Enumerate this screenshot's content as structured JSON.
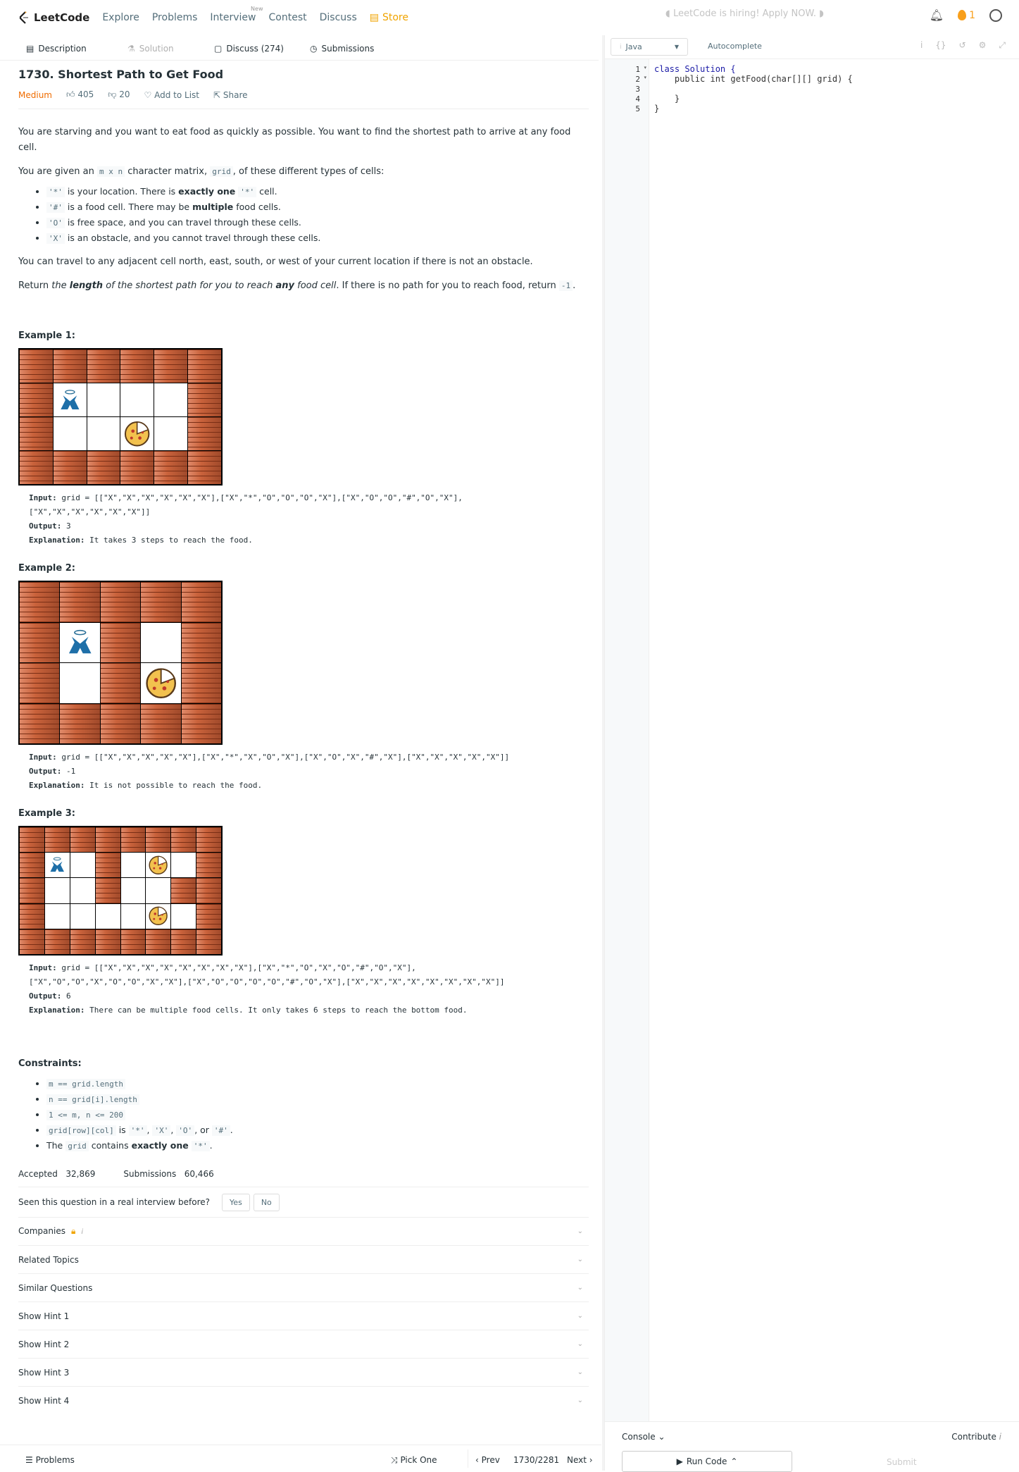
{
  "nav": {
    "logo": "LeetCode",
    "explore": "Explore",
    "problems": "Problems",
    "interview": "Interview",
    "new_badge": "New",
    "contest": "Contest",
    "discuss": "Discuss",
    "store": "Store",
    "hiring": "LeetCode is hiring! Apply NOW.",
    "streak": "1"
  },
  "tabs": {
    "description": "Description",
    "solution": "Solution",
    "discuss": "Discuss (274)",
    "submissions": "Submissions"
  },
  "problem": {
    "title": "1730. Shortest Path to Get Food",
    "difficulty": "Medium",
    "likes": "405",
    "dislikes": "20",
    "add_to_list": "Add to List",
    "share": "Share",
    "p1": "You are starving and you want to eat food as quickly as possible. You want to find the shortest path to arrive at any food cell.",
    "p2a": "You are given an ",
    "p2code1": "m x n",
    "p2b": " character matrix, ",
    "p2code2": "grid",
    "p2c": ", of these different types of cells:",
    "bullets": [
      {
        "code": "'*'",
        "t1": " is your location. There is ",
        "b": "exactly one",
        "t2": " ",
        "code2": "'*'",
        "t3": " cell."
      },
      {
        "code": "'#'",
        "t1": " is a food cell. There may be ",
        "b": "multiple",
        "t2": " food cells.",
        "code2": "",
        "t3": ""
      },
      {
        "code": "'O'",
        "t1": " is free space, and you can travel through these cells.",
        "b": "",
        "t2": "",
        "code2": "",
        "t3": ""
      },
      {
        "code": "'X'",
        "t1": " is an obstacle, and you cannot travel through these cells.",
        "b": "",
        "t2": "",
        "code2": "",
        "t3": ""
      }
    ],
    "p3": "You can travel to any adjacent cell north, east, south, or west of your current location if there is not an obstacle.",
    "p4a": "Return ",
    "p4b": "the ",
    "p4c": "length",
    "p4d": " of the shortest path for you to reach ",
    "p4e": "any",
    "p4f": " food cell",
    "p4g": ". If there is no path for you to reach food, return ",
    "p4code": "-1",
    "p4h": "."
  },
  "examples": [
    {
      "label": "Example 1:",
      "input_label": "Input:",
      "input": " grid = [[\"X\",\"X\",\"X\",\"X\",\"X\",\"X\"],[\"X\",\"*\",\"O\",\"O\",\"O\",\"X\"],[\"X\",\"O\",\"O\",\"#\",\"O\",\"X\"],\n[\"X\",\"X\",\"X\",\"X\",\"X\",\"X\"]]",
      "output_label": "Output:",
      "output": " 3",
      "explanation_label": "Explanation:",
      "explanation": " It takes 3 steps to reach the food.",
      "grid": [
        "XXXXXX",
        "X*OOOX",
        "XOO#OX",
        "XXXXXX"
      ]
    },
    {
      "label": "Example 2:",
      "input_label": "Input:",
      "input": " grid = [[\"X\",\"X\",\"X\",\"X\",\"X\"],[\"X\",\"*\",\"X\",\"O\",\"X\"],[\"X\",\"O\",\"X\",\"#\",\"X\"],[\"X\",\"X\",\"X\",\"X\",\"X\"]]",
      "output_label": "Output:",
      "output": " -1",
      "explanation_label": "Explanation:",
      "explanation": " It is not possible to reach the food.",
      "grid": [
        "XXXXX",
        "X*XOX",
        "XOX#X",
        "XXXXX"
      ]
    },
    {
      "label": "Example 3:",
      "input_label": "Input:",
      "input": " grid = [[\"X\",\"X\",\"X\",\"X\",\"X\",\"X\",\"X\",\"X\"],[\"X\",\"*\",\"O\",\"X\",\"O\",\"#\",\"O\",\"X\"],\n[\"X\",\"O\",\"O\",\"X\",\"O\",\"O\",\"X\",\"X\"],[\"X\",\"O\",\"O\",\"O\",\"O\",\"#\",\"O\",\"X\"],[\"X\",\"X\",\"X\",\"X\",\"X\",\"X\",\"X\",\"X\"]]",
      "output_label": "Output:",
      "output": " 6",
      "explanation_label": "Explanation:",
      "explanation": " There can be multiple food cells. It only takes 6 steps to reach the bottom food.",
      "grid": [
        "XXXXXXXX",
        "X*OXO#OX",
        "XOOXOOXX",
        "XOOOO#OX",
        "XXXXXXXX"
      ]
    }
  ],
  "constraints": {
    "label": "Constraints:",
    "items": [
      {
        "code": "m == grid.length",
        "t": ""
      },
      {
        "code": "n == grid[i].length",
        "t": ""
      },
      {
        "code": "1 <= m, n <= 200",
        "t": ""
      },
      {
        "code": "grid[row][col]",
        "t": " is ",
        "c2": "'*'",
        "t2": ", ",
        "c3": "'X'",
        "t3": ", ",
        "c4": "'O'",
        "t4": ", or ",
        "c5": "'#'",
        "t5": "."
      },
      {
        "pre": "The ",
        "code": "grid",
        "t": " contains ",
        "b": "exactly one",
        "c2": "'*'",
        "t2": "."
      }
    ]
  },
  "stats": {
    "accepted_label": "Accepted",
    "accepted": "32,869",
    "submissions_label": "Submissions",
    "submissions": "60,466"
  },
  "seen": {
    "question": "Seen this question in a real interview before?",
    "yes": "Yes",
    "no": "No"
  },
  "sections": [
    "Companies",
    "Related Topics",
    "Similar Questions",
    "Show Hint 1",
    "Show Hint 2",
    "Show Hint 3",
    "Show Hint 4"
  ],
  "editor": {
    "language": "Java",
    "autocomplete": "Autocomplete",
    "lines": [
      "class Solution {",
      "    public int getFood(char[][] grid) {",
      "        ",
      "    }",
      "}"
    ],
    "line_numbers": [
      "1",
      "2",
      "3",
      "4",
      "5"
    ]
  },
  "footer": {
    "problems": "Problems",
    "pick_one": "Pick One",
    "prev": "Prev",
    "page": "1730/2281",
    "next": "Next",
    "console": "Console",
    "contribute": "Contribute",
    "run_code": "Run Code",
    "submit": "Submit"
  }
}
